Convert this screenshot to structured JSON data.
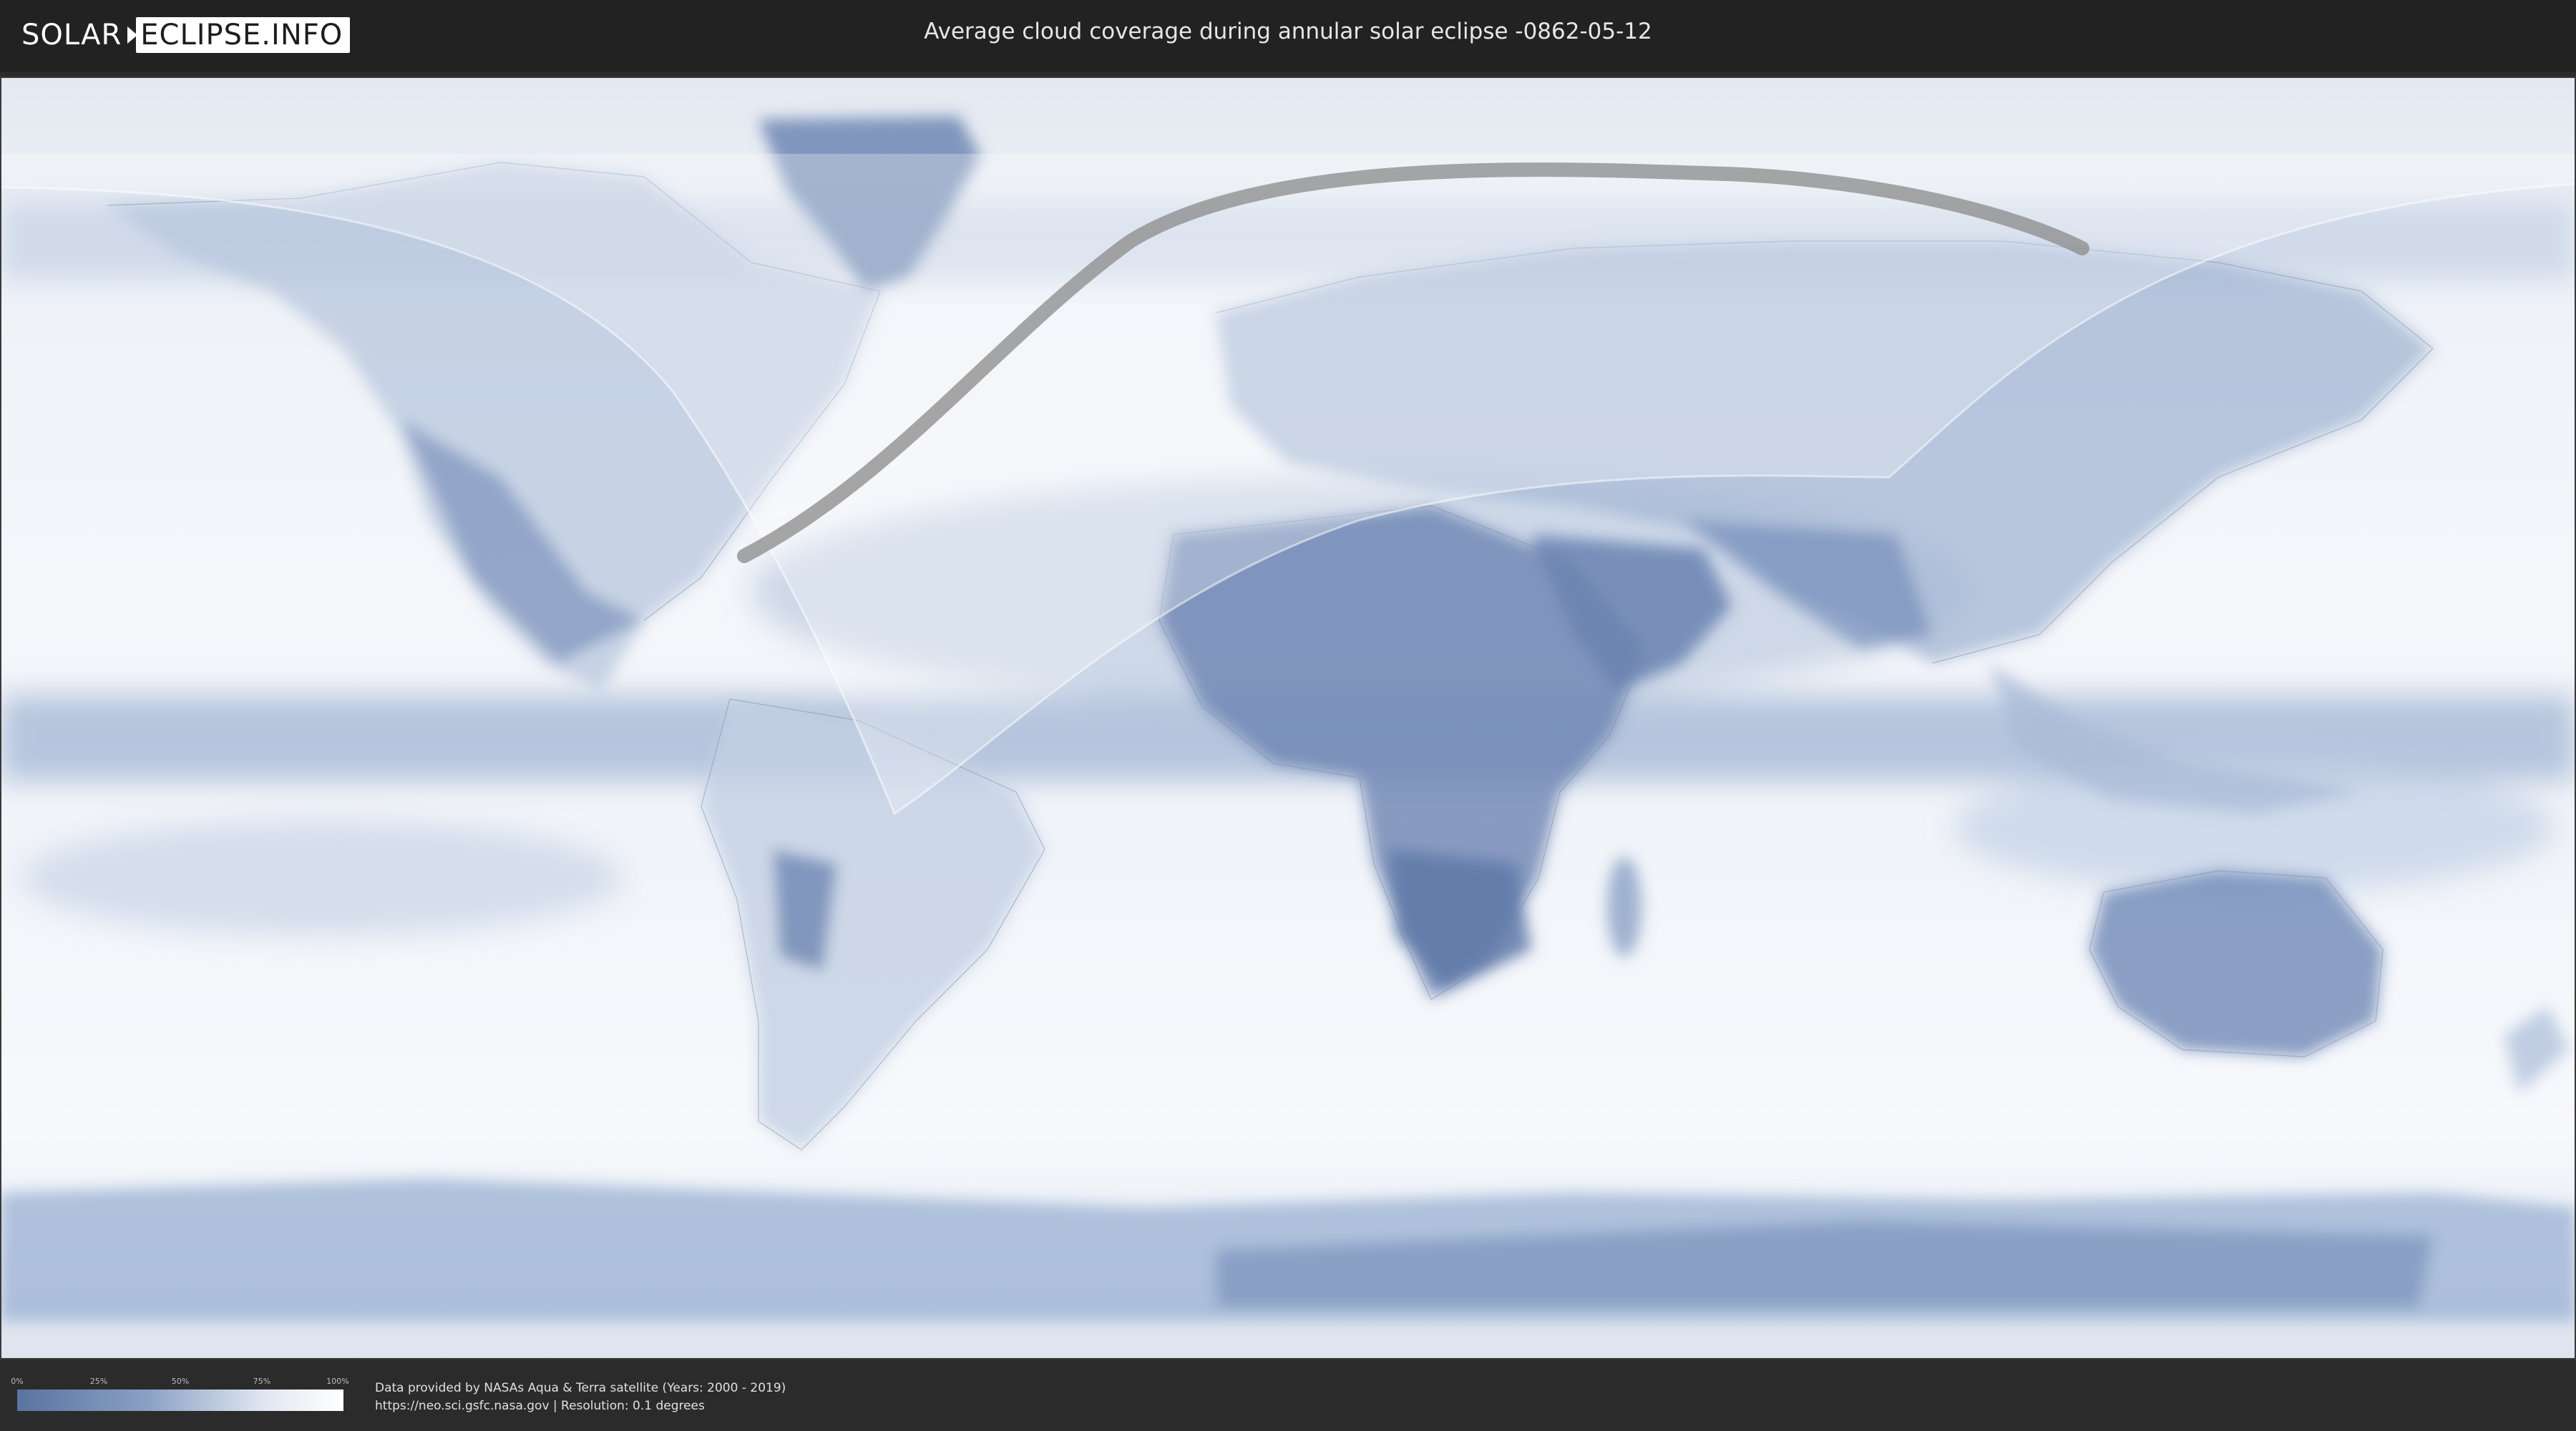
{
  "header": {
    "logo_left": "SOLAR",
    "logo_right": "ECLIPSE.INFO",
    "title": "Average cloud coverage during annular solar eclipse -0862-05-12"
  },
  "legend": {
    "ticks": [
      "0%",
      "25%",
      "50%",
      "75%",
      "100%"
    ],
    "colors": {
      "low": "#5a73a0",
      "high": "#ffffff"
    }
  },
  "credits": {
    "line1": "Data provided by NASAs Aqua & Terra satellite (Years: 2000 - 2019)",
    "line2": "https://neo.sci.gsfc.nasa.gov | Resolution: 0.1 degrees"
  },
  "map": {
    "ocean_color": "#eef2f8",
    "cloud_band_color": "#9fb3d2",
    "land_color": "#6f87b3",
    "eclipse_path_color": "#8a8a8a"
  }
}
